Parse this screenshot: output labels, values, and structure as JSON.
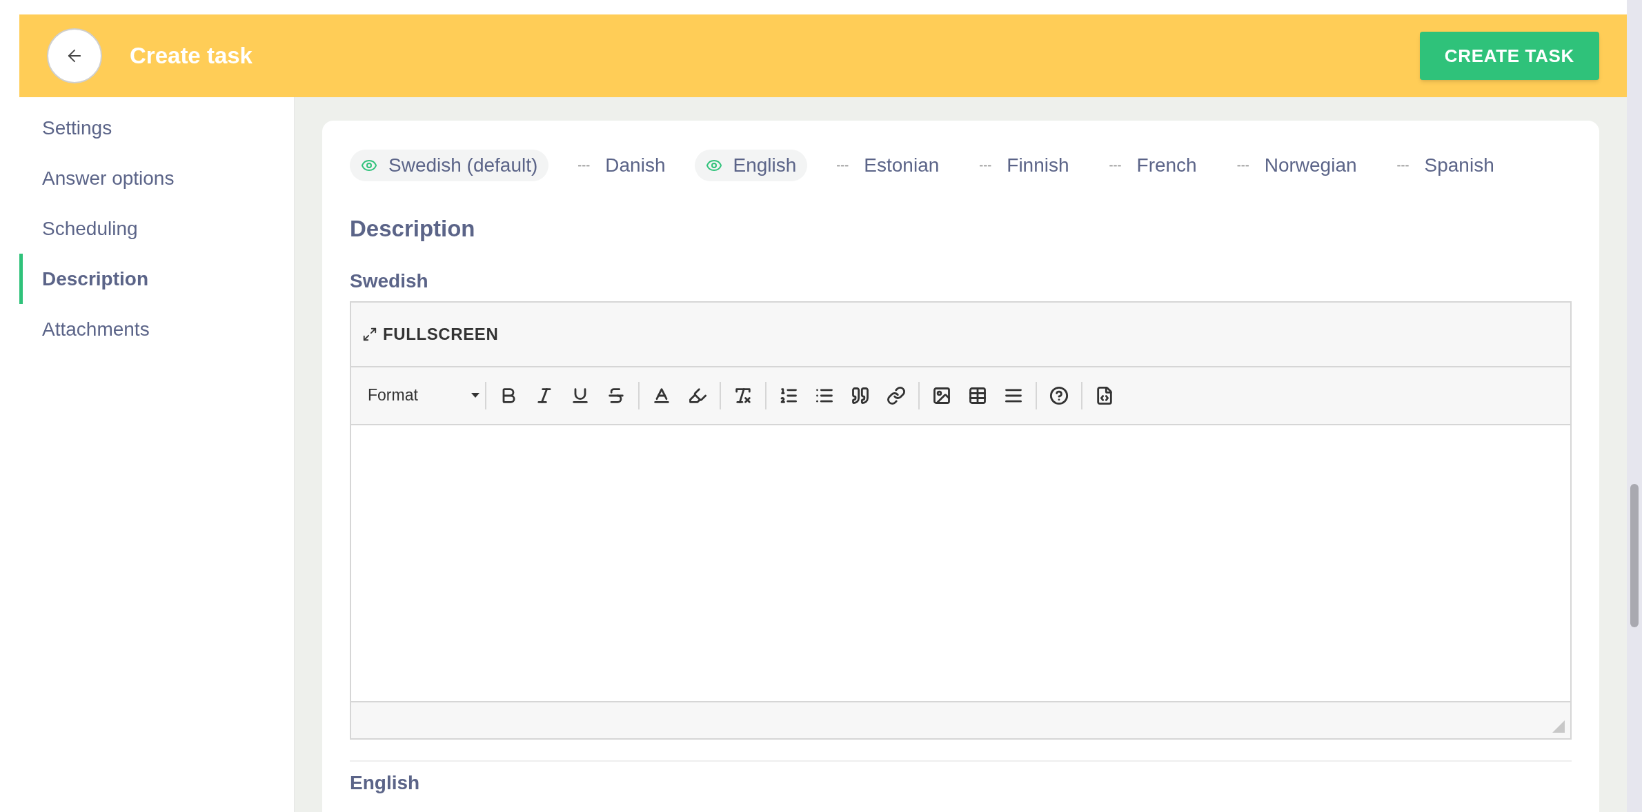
{
  "header": {
    "title": "Create task",
    "action": "CREATE TASK"
  },
  "sidebar": {
    "items": [
      {
        "label": "Settings",
        "selected": false
      },
      {
        "label": "Answer options",
        "selected": false
      },
      {
        "label": "Scheduling",
        "selected": false
      },
      {
        "label": "Description",
        "selected": true
      },
      {
        "label": "Attachments",
        "selected": false
      }
    ]
  },
  "languages": [
    {
      "label": "Swedish (default)",
      "kind": "visible"
    },
    {
      "label": "Danish",
      "kind": "hidden",
      "marker": "---"
    },
    {
      "label": "English",
      "kind": "visible"
    },
    {
      "label": "Estonian",
      "kind": "hidden",
      "marker": "---"
    },
    {
      "label": "Finnish",
      "kind": "hidden",
      "marker": "---"
    },
    {
      "label": "French",
      "kind": "hidden",
      "marker": "---"
    },
    {
      "label": "Norwegian",
      "kind": "hidden",
      "marker": "---"
    },
    {
      "label": "Spanish",
      "kind": "hidden",
      "marker": "---"
    }
  ],
  "section_title": "Description",
  "editors": [
    {
      "language": "Swedish",
      "fullscreen": "FULLSCREEN",
      "format": "Format"
    },
    {
      "language": "English"
    }
  ]
}
